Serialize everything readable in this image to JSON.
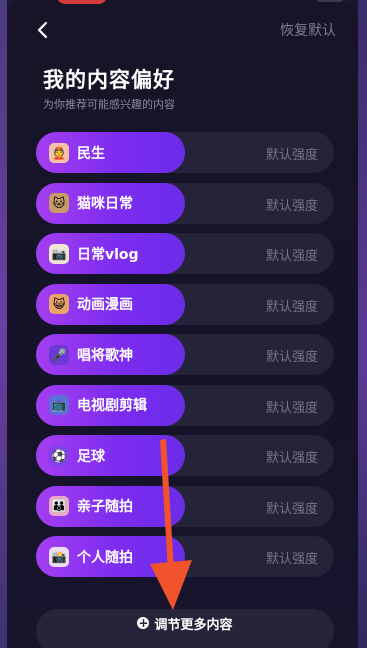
{
  "header": {
    "reset_label": "恢复默认",
    "title": "我的内容偏好",
    "subtitle": "为你推荐可能感兴趣的内容"
  },
  "preferences": [
    {
      "label": "民生",
      "strength": "默认强度",
      "icon": "people-icon"
    },
    {
      "label": "猫咪日常",
      "strength": "默认强度",
      "icon": "cat-icon"
    },
    {
      "label": "日常vlog",
      "strength": "默认强度",
      "icon": "vlog-icon"
    },
    {
      "label": "动画漫画",
      "strength": "默认强度",
      "icon": "anime-icon"
    },
    {
      "label": "唱将歌神",
      "strength": "默认强度",
      "icon": "music-icon"
    },
    {
      "label": "电视剧剪辑",
      "strength": "默认强度",
      "icon": "tv-icon"
    },
    {
      "label": "足球",
      "strength": "默认强度",
      "icon": "soccer-ball-icon"
    },
    {
      "label": "亲子随拍",
      "strength": "默认强度",
      "icon": "family-icon"
    },
    {
      "label": "个人随拍",
      "strength": "默认强度",
      "icon": "camera-icon"
    }
  ],
  "footer": {
    "more_label": "调节更多内容"
  },
  "colors": {
    "pill_start": "#a43ff0",
    "pill_end": "#6a2ce8",
    "annotation_arrow": "#f0522b"
  }
}
